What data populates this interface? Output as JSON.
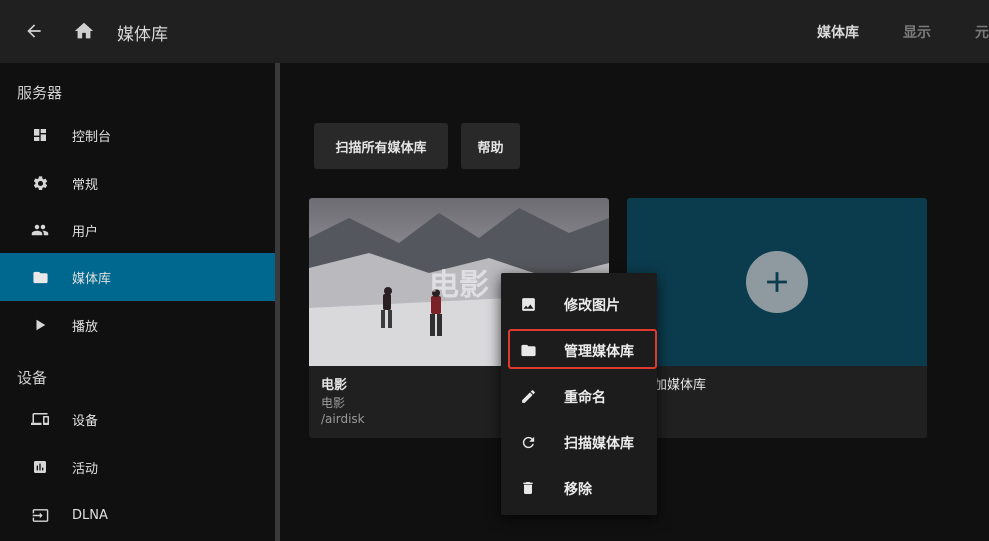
{
  "header": {
    "back_icon": "arrow-left-icon",
    "home_icon": "home-icon",
    "title": "媒体库",
    "tabs": [
      {
        "label": "媒体库",
        "active": true
      },
      {
        "label": "显示",
        "active": false
      },
      {
        "label": "元数"
      }
    ]
  },
  "sidebar": {
    "sections": [
      {
        "title": "服务器",
        "items": [
          {
            "label": "控制台",
            "icon": "dashboard-icon"
          },
          {
            "label": "常规",
            "icon": "gear-icon"
          },
          {
            "label": "用户",
            "icon": "users-icon"
          },
          {
            "label": "媒体库",
            "icon": "folder-icon",
            "selected": true
          },
          {
            "label": "播放",
            "icon": "play-icon"
          }
        ]
      },
      {
        "title": "设备",
        "items": [
          {
            "label": "设备",
            "icon": "devices-icon"
          },
          {
            "label": "活动",
            "icon": "activity-icon"
          },
          {
            "label": "DLNA",
            "icon": "input-icon"
          }
        ]
      }
    ]
  },
  "main": {
    "buttons": {
      "scan_all": "扫描所有媒体库",
      "help": "帮助"
    },
    "library_card": {
      "overlay_title": "电影",
      "name": "电影",
      "type": "电影",
      "path": "/airdisk"
    },
    "add_card": {
      "label": "加媒体库",
      "icon": "plus-icon"
    }
  },
  "context_menu": {
    "items": [
      {
        "label": "修改图片",
        "icon": "image-icon"
      },
      {
        "label": "管理媒体库",
        "icon": "folder-icon",
        "highlighted": true
      },
      {
        "label": "重命名",
        "icon": "pencil-icon"
      },
      {
        "label": "扫描媒体库",
        "icon": "refresh-icon"
      },
      {
        "label": "移除",
        "icon": "trash-icon"
      }
    ]
  },
  "colors": {
    "accent": "#00688f",
    "highlight_border": "#e03a2f",
    "header_bg": "#202020",
    "page_bg": "#101010"
  }
}
